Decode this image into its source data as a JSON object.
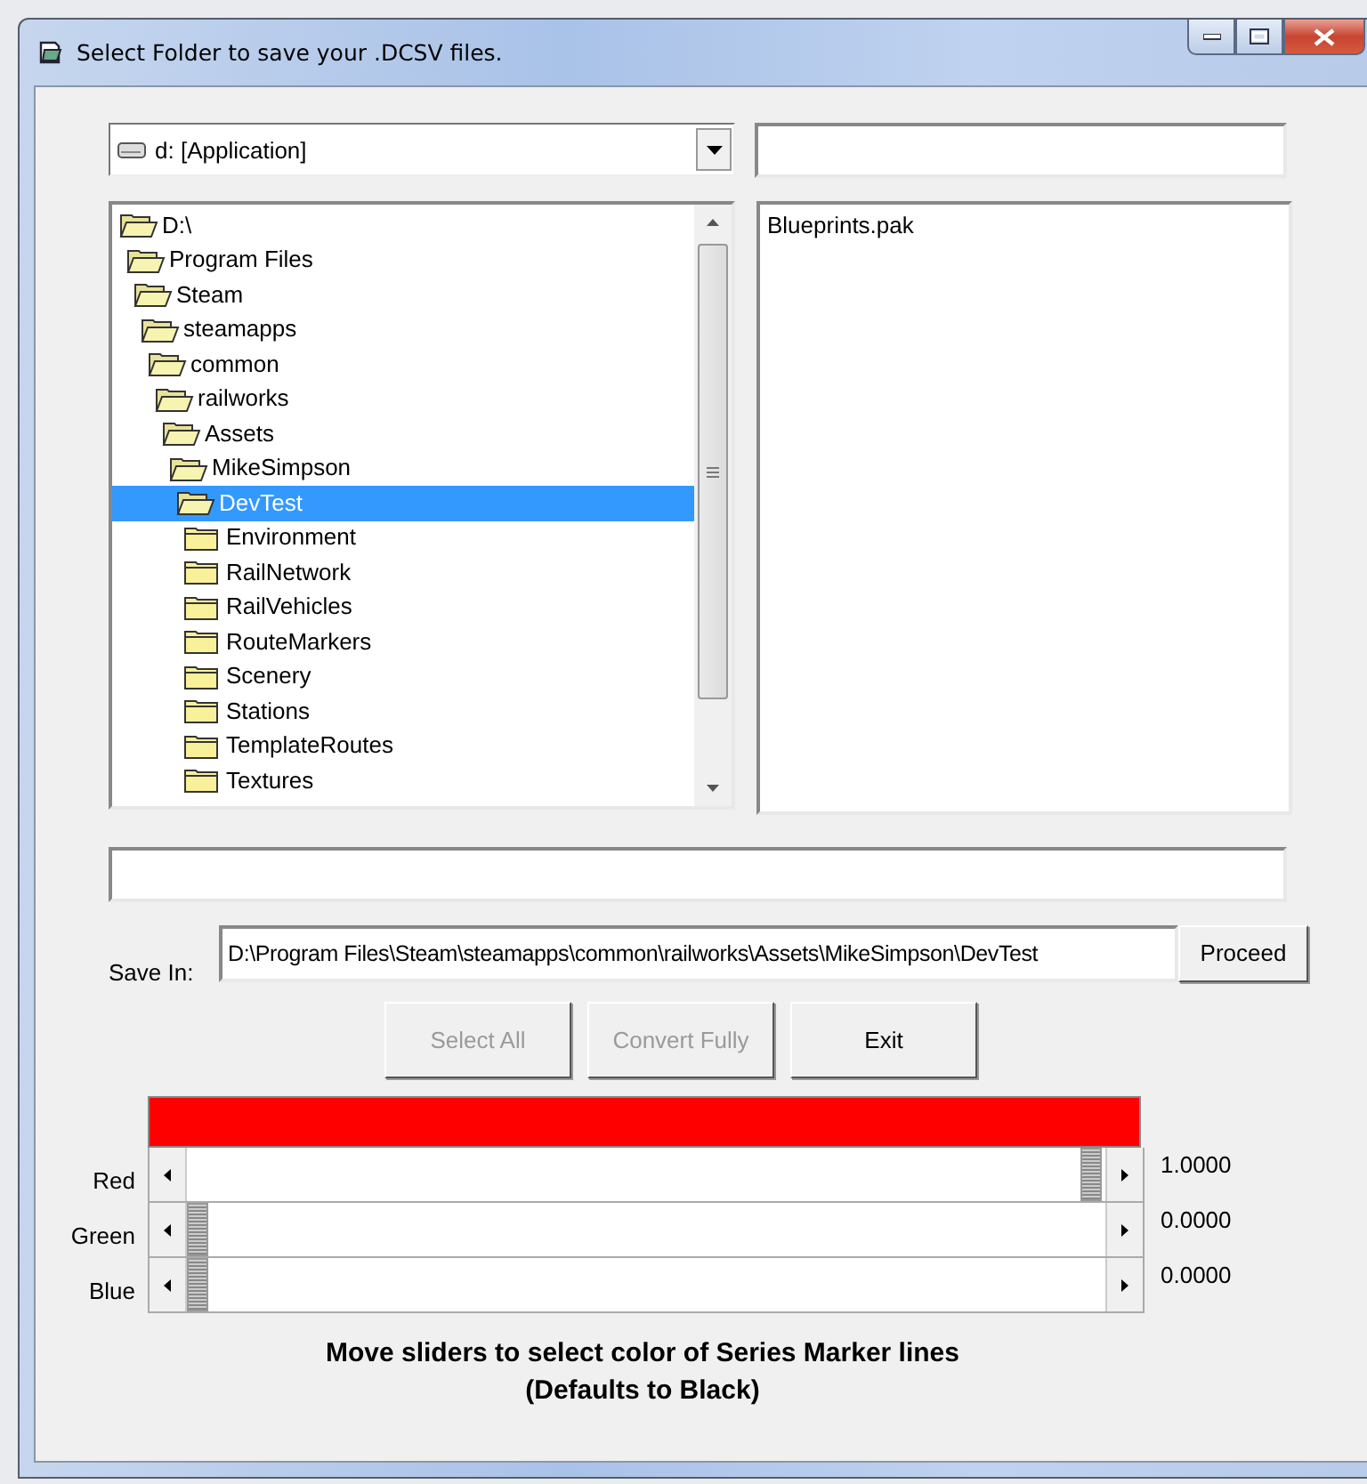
{
  "window": {
    "title": "Select Folder to save your .DCSV files."
  },
  "drive": {
    "value": "d: [Application]"
  },
  "folders": [
    {
      "name": "D:\\",
      "expanded": true,
      "selected": false,
      "children": [
        {
          "name": "Program Files",
          "expanded": true,
          "selected": false,
          "children": [
            {
              "name": "Steam",
              "expanded": true,
              "selected": false,
              "children": [
                {
                  "name": "steamapps",
                  "expanded": true,
                  "selected": false,
                  "children": [
                    {
                      "name": "common",
                      "expanded": true,
                      "selected": false,
                      "children": [
                        {
                          "name": "railworks",
                          "expanded": true,
                          "selected": false,
                          "children": [
                            {
                              "name": "Assets",
                              "expanded": true,
                              "selected": false,
                              "children": [
                                {
                                  "name": "MikeSimpson",
                                  "expanded": true,
                                  "selected": false,
                                  "children": [
                                    {
                                      "name": "DevTest",
                                      "expanded": true,
                                      "selected": true,
                                      "children": [
                                        {
                                          "name": "Environment",
                                          "expanded": false,
                                          "selected": false
                                        },
                                        {
                                          "name": "RailNetwork",
                                          "expanded": false,
                                          "selected": false
                                        },
                                        {
                                          "name": "RailVehicles",
                                          "expanded": false,
                                          "selected": false
                                        },
                                        {
                                          "name": "RouteMarkers",
                                          "expanded": false,
                                          "selected": false
                                        },
                                        {
                                          "name": "Scenery",
                                          "expanded": false,
                                          "selected": false
                                        },
                                        {
                                          "name": "Stations",
                                          "expanded": false,
                                          "selected": false
                                        },
                                        {
                                          "name": "TemplateRoutes",
                                          "expanded": false,
                                          "selected": false
                                        },
                                        {
                                          "name": "Textures",
                                          "expanded": false,
                                          "selected": false
                                        }
                                      ]
                                    }
                                  ]
                                }
                              ]
                            }
                          ]
                        }
                      ]
                    }
                  ]
                }
              ]
            }
          ]
        }
      ]
    }
  ],
  "files": [
    {
      "name": "Blueprints.pak"
    }
  ],
  "save_in": {
    "label": "Save In:",
    "value": "D:\\Program Files\\Steam\\steamapps\\common\\railworks\\Assets\\MikeSimpson\\DevTest",
    "button": "Proceed"
  },
  "buttons": [
    {
      "label": "Select All",
      "disabled": true
    },
    {
      "label": "Convert Fully",
      "disabled": true
    },
    {
      "label": "Exit",
      "disabled": false
    }
  ],
  "sliders": [
    {
      "name": "Red",
      "level": 1,
      "reading": "1.0000"
    },
    {
      "name": "Green",
      "level": 0,
      "reading": "0.0000"
    },
    {
      "name": "Blue",
      "level": 0,
      "reading": "0.0000"
    }
  ],
  "instructions": [
    "Move sliders to select color of Series Marker lines",
    "(Defaults to Black)"
  ]
}
